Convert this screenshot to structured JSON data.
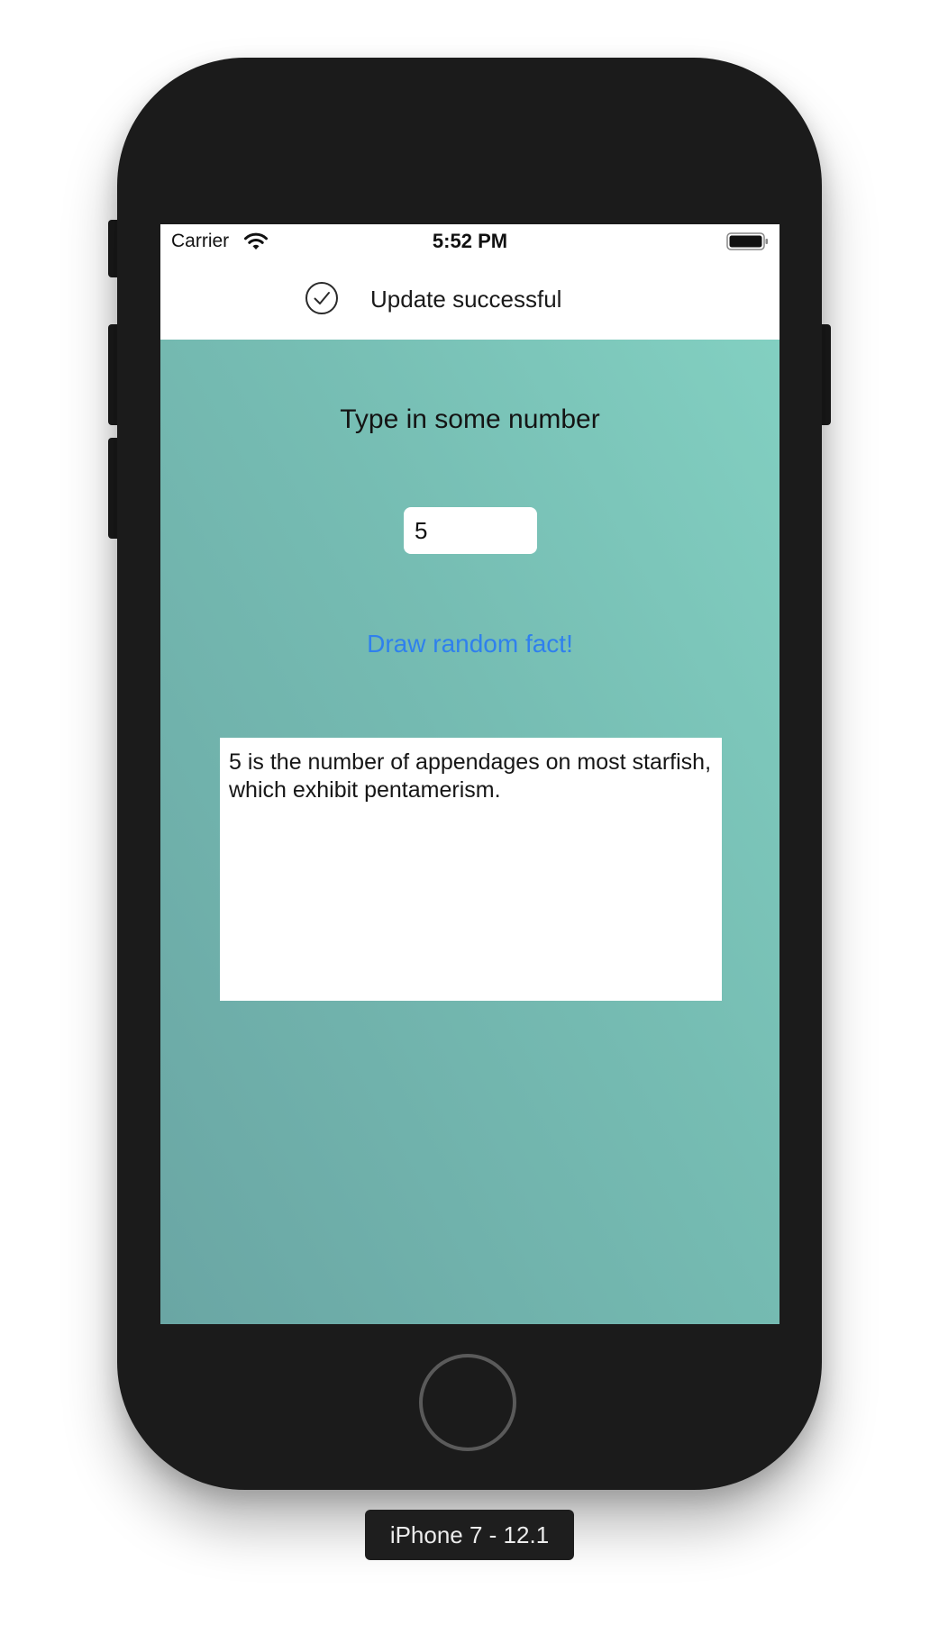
{
  "status_bar": {
    "carrier": "Carrier",
    "time": "5:52 PM",
    "wifi_icon": "wifi-icon",
    "battery_icon": "battery-full-icon"
  },
  "banner": {
    "icon": "checkmark-circle-icon",
    "text": "Update successful"
  },
  "main": {
    "prompt": "Type in some number",
    "number_input_value": "5",
    "draw_button_label": "Draw random fact!",
    "fact_text": "5 is the number of appendages on most starfish, which exhibit pentamerism."
  },
  "device": {
    "label": "iPhone 7 - 12.1"
  },
  "colors": {
    "accent_blue": "#2f80ed",
    "gradient_light": "#84d2c3",
    "gradient_dark": "#6aa6a4",
    "phone_body": "#1b1b1b"
  }
}
